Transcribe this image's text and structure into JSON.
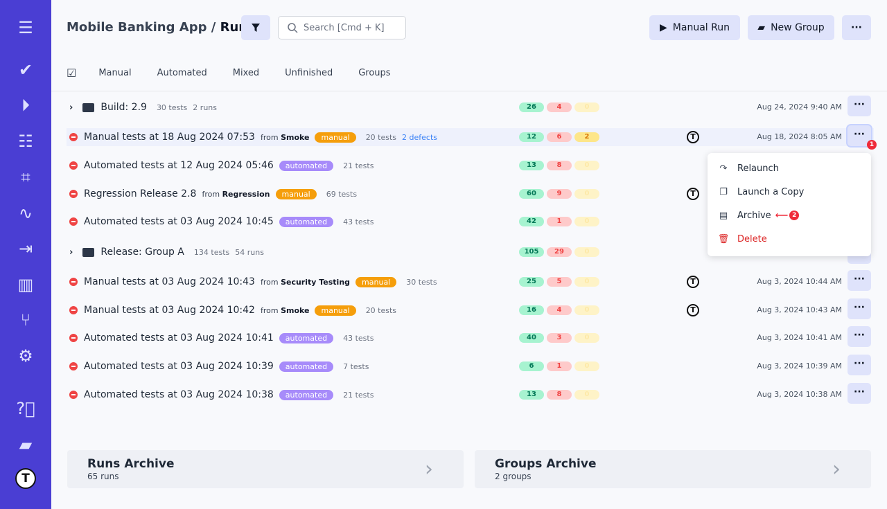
{
  "colors": {
    "sidebar": "#4a3ed3",
    "pass": "#a7f3d0",
    "fail": "#fecaca",
    "skip": "#fef3c7",
    "manual_tag": "#f59e0b",
    "automated_tag": "#a78bfa",
    "danger": "#ef4444"
  },
  "sidebar": {
    "icons": [
      "menu-icon",
      "check-icon",
      "play-circle-icon",
      "checklist-icon",
      "steps-icon",
      "pulse-icon",
      "import-icon",
      "chart-icon",
      "branch-icon",
      "gear-icon",
      "help-icon",
      "folder-icon",
      "logo-icon"
    ]
  },
  "header": {
    "project": "Mobile Banking App",
    "separator": "/",
    "page": "Runs",
    "search_placeholder": "Search [Cmd + K]",
    "manual_run": "Manual Run",
    "new_group": "New Group",
    "more": "···"
  },
  "tabs": [
    "Manual",
    "Automated",
    "Mixed",
    "Unfinished",
    "Groups"
  ],
  "rows": [
    {
      "type": "group",
      "name": "Build: 2.9",
      "tests": "30 tests",
      "runs": "2 runs",
      "counts": [
        26,
        4,
        0
      ],
      "date": "Aug 24, 2024 9:40 AM"
    },
    {
      "type": "run",
      "name": "Manual tests at 18 Aug 2024 07:53",
      "from": "Smoke",
      "tag": "manual",
      "tests": "20 tests",
      "defects": "2 defects",
      "counts": [
        12,
        6,
        2
      ],
      "avatar": true,
      "date": "Aug 18, 2024 8:05 AM",
      "highlight": true
    },
    {
      "type": "run",
      "name": "Automated tests at 12 Aug 2024 05:46",
      "tag": "automated",
      "tests": "21 tests",
      "counts": [
        13,
        8,
        0
      ]
    },
    {
      "type": "run",
      "name": "Regression Release 2.8",
      "from": "Regression",
      "tag": "manual",
      "tests": "69 tests",
      "counts": [
        60,
        9,
        0
      ],
      "avatar": true
    },
    {
      "type": "run",
      "name": "Automated tests at 03 Aug 2024 10:45",
      "tag": "automated",
      "tests": "43 tests",
      "counts": [
        42,
        1,
        0
      ]
    },
    {
      "type": "group",
      "name": "Release: Group A",
      "tests": "134 tests",
      "runs": "54 runs",
      "counts": [
        105,
        29,
        0
      ]
    },
    {
      "type": "run",
      "name": "Manual tests at 03 Aug 2024 10:43",
      "from": "Security Testing",
      "tag": "manual",
      "tests": "30 tests",
      "counts": [
        25,
        5,
        0
      ],
      "avatar": true,
      "date": "Aug 3, 2024 10:44 AM"
    },
    {
      "type": "run",
      "name": "Manual tests at 03 Aug 2024 10:42",
      "from": "Smoke",
      "tag": "manual",
      "tests": "20 tests",
      "counts": [
        16,
        4,
        0
      ],
      "avatar": true,
      "date": "Aug 3, 2024 10:43 AM"
    },
    {
      "type": "run",
      "name": "Automated tests at 03 Aug 2024 10:41",
      "tag": "automated",
      "tests": "43 tests",
      "counts": [
        40,
        3,
        0
      ],
      "date": "Aug 3, 2024 10:41 AM"
    },
    {
      "type": "run",
      "name": "Automated tests at 03 Aug 2024 10:39",
      "tag": "automated",
      "tests": "7 tests",
      "counts": [
        6,
        1,
        0
      ],
      "date": "Aug 3, 2024 10:39 AM"
    },
    {
      "type": "run",
      "name": "Automated tests at 03 Aug 2024 10:38",
      "tag": "automated",
      "tests": "21 tests",
      "counts": [
        13,
        8,
        0
      ],
      "date": "Aug 3, 2024 10:38 AM"
    }
  ],
  "from_label": "from",
  "menu": {
    "relaunch": "Relaunch",
    "copy": "Launch a Copy",
    "archive": "Archive",
    "delete": "Delete",
    "step1": "1",
    "step2": "2"
  },
  "archives": [
    {
      "title": "Runs Archive",
      "sub": "65 runs"
    },
    {
      "title": "Groups Archive",
      "sub": "2 groups"
    }
  ]
}
